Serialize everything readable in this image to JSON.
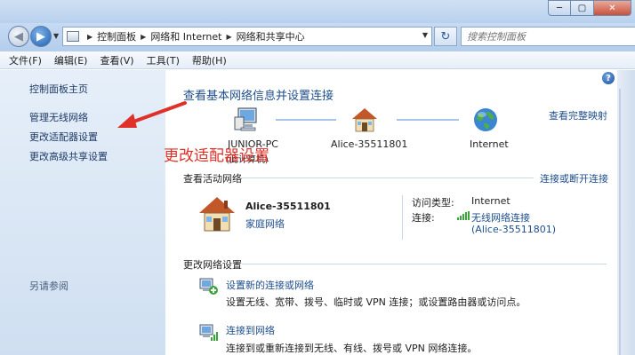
{
  "window": {
    "min_glyph": "─",
    "max_glyph": "▢",
    "close_glyph": "✕"
  },
  "address_bar": {
    "back_glyph": "◀",
    "forward_glyph": "▶",
    "breadcrumbs": [
      "控制面板",
      "网络和 Internet",
      "网络和共享中心"
    ],
    "refresh_glyph": "↻",
    "search_placeholder": "搜索控制面板"
  },
  "menu": [
    "文件(F)",
    "编辑(E)",
    "查看(V)",
    "工具(T)",
    "帮助(H)"
  ],
  "left_pane": {
    "links": [
      "控制面板主页",
      "管理无线网络",
      "更改适配器设置",
      "更改高级共享设置"
    ],
    "see_also": "另请参阅"
  },
  "main": {
    "title": "查看基本网络信息并设置连接",
    "full_map_link": "查看完整映射",
    "map_nodes": {
      "computer": "JUNIOR-PC",
      "computer_sub": "(此计算机)",
      "network": "Alice-35511801",
      "internet": "Internet"
    },
    "active_networks": {
      "title": "查看活动网络",
      "connect_link": "连接或断开连接",
      "network_name": "Alice-35511801",
      "network_type": "家庭网络",
      "access_type_label": "访问类型:",
      "access_type_value": "Internet",
      "connection_label": "连接:",
      "connection_value": "无线网络连接",
      "connection_ssid": "(Alice-35511801)"
    },
    "change_settings": {
      "title": "更改网络设置",
      "tasks": [
        {
          "link": "设置新的连接或网络",
          "desc": "设置无线、宽带、拨号、临时或 VPN 连接；或设置路由器或访问点。"
        },
        {
          "link": "连接到网络",
          "desc": "连接到或重新连接到无线、有线、拨号或 VPN 网络连接。"
        }
      ]
    }
  },
  "annotation": {
    "text": "更改适配器设置",
    "color": "#e0302a"
  }
}
